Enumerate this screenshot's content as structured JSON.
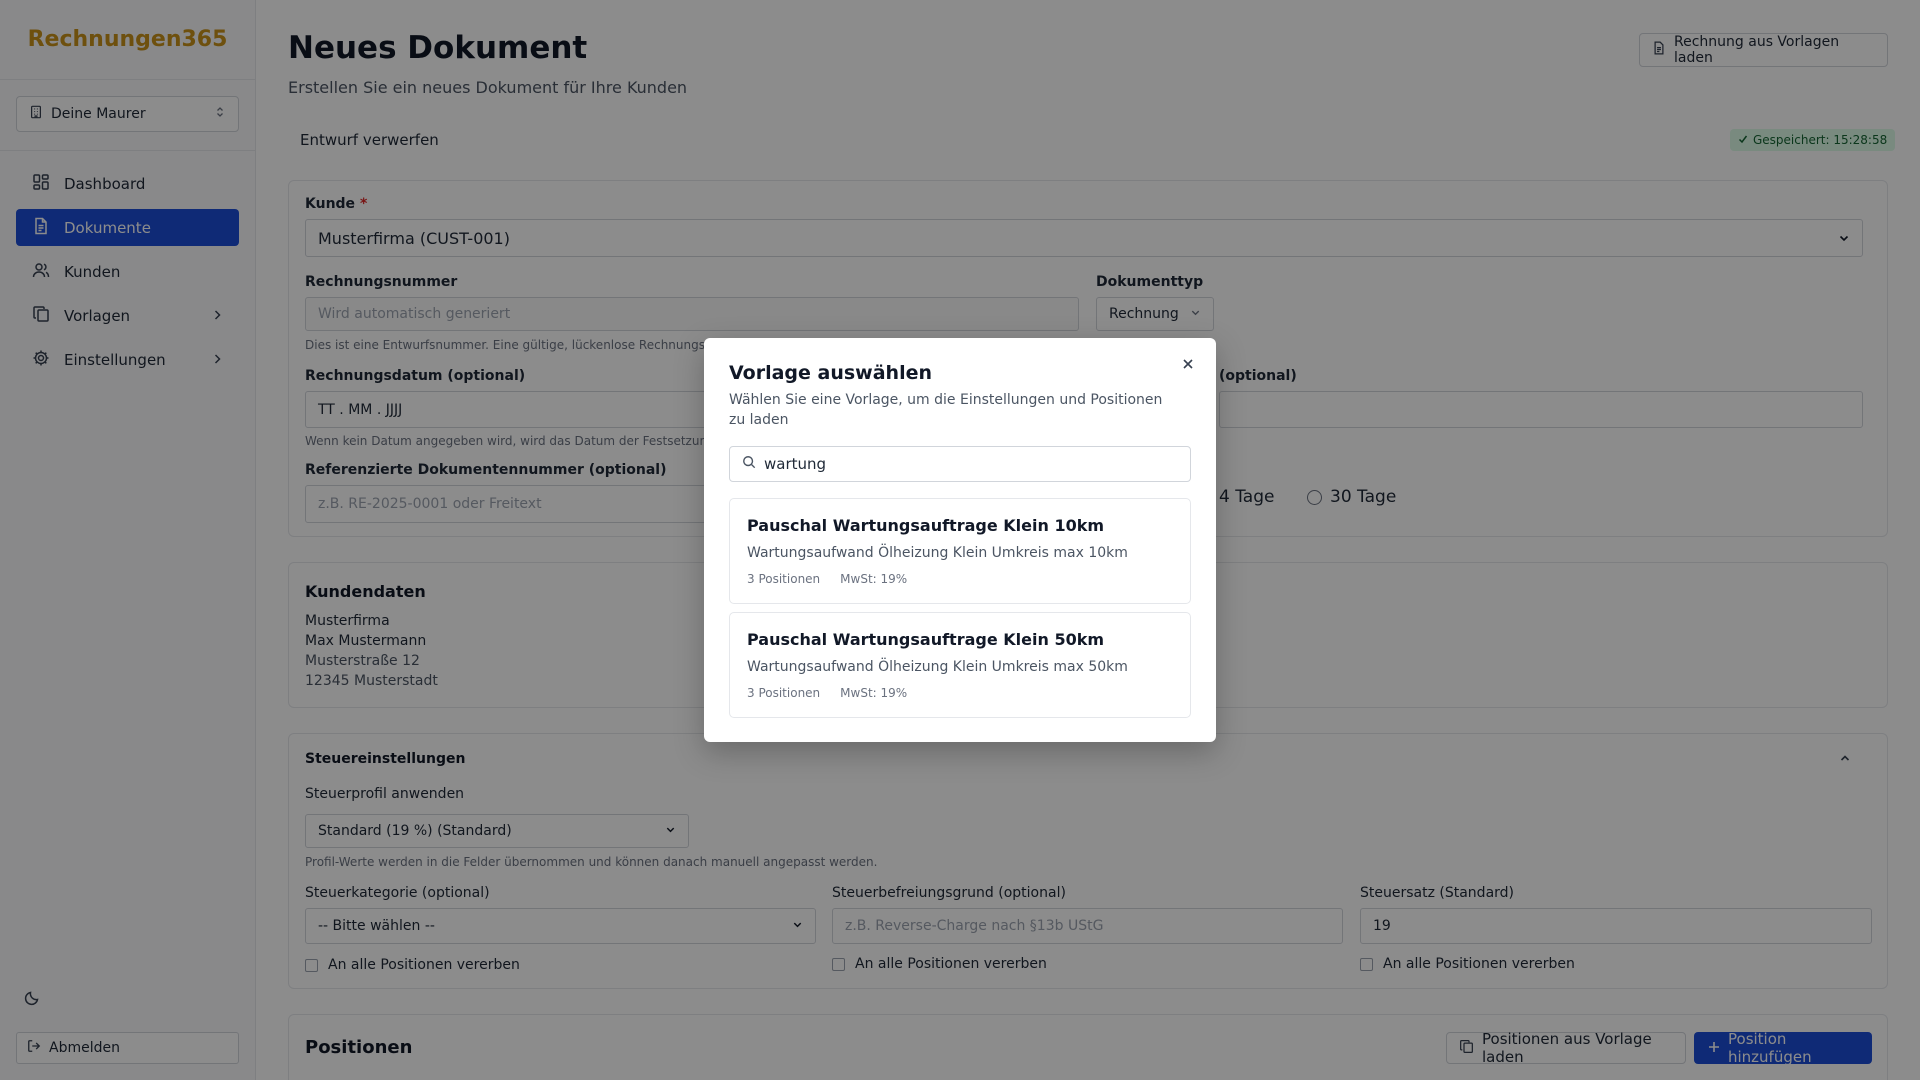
{
  "app": {
    "brand": "Rechnungen365"
  },
  "sidebar": {
    "company": "Deine Maurer",
    "items": [
      {
        "label": "Dashboard",
        "icon": "grid-icon"
      },
      {
        "label": "Dokumente",
        "icon": "document-icon",
        "active": true
      },
      {
        "label": "Kunden",
        "icon": "users-icon"
      },
      {
        "label": "Vorlagen",
        "icon": "copy-icon",
        "expandable": true
      },
      {
        "label": "Einstellungen",
        "icon": "gear-icon",
        "expandable": true
      }
    ],
    "logout": "Abmelden"
  },
  "header": {
    "title": "Neues Dokument",
    "subtitle": "Erstellen Sie ein neues Dokument für Ihre Kunden",
    "load_invoice_button": "Rechnung aus Vorlagen laden",
    "discard": "Entwurf verwerfen",
    "saved": "Gespeichert: 15:28:58"
  },
  "form": {
    "customer_label": "Kunde",
    "required_mark": "*",
    "customer_value": "Musterfirma (CUST-001)",
    "invoice_number_label": "Rechnungsnummer",
    "invoice_number_placeholder": "Wird automatisch generiert",
    "invoice_number_hint": "Dies ist eine Entwurfsnummer. Eine gültige, lückenlose Rechnungsnum",
    "doc_type_label": "Dokumenttyp",
    "doc_type_value": "Rechnung",
    "invoice_date_label": "Rechnungsdatum (optional)",
    "invoice_date_value": "TT . MM . JJJJ",
    "invoice_date_hint": "Wenn kein Datum angegeben wird, wird das Datum der Festsetzung ve",
    "right_optional_label": "(optional)",
    "ref_doc_label": "Referenzierte Dokumentennummer (optional)",
    "ref_doc_placeholder": "z.B. RE-2025-0001 oder Freitext",
    "radio_partial": "4 Tage",
    "radio_30": "30 Tage"
  },
  "customer_data": {
    "title": "Kundendaten",
    "company": "Musterfirma",
    "person": "Max Mustermann",
    "street": "Musterstraße 12",
    "city": "12345 Musterstadt"
  },
  "tax": {
    "title": "Steuereinstellungen",
    "profile_label": "Steuerprofil anwenden",
    "profile_value": "Standard (19 %) (Standard)",
    "profile_hint": "Profil-Werte werden in die Felder übernommen und können danach manuell angepasst werden.",
    "category_label": "Steuerkategorie (optional)",
    "category_value": "-- Bitte wählen --",
    "exemption_label": "Steuerbefreiungsgrund (optional)",
    "exemption_placeholder": "z.B. Reverse-Charge nach §13b UStG",
    "rate_label": "Steuersatz (Standard)",
    "rate_value": "19",
    "inherit": "An alle Positionen vererben"
  },
  "positions": {
    "title": "Positionen",
    "load_button": "Positionen aus Vorlage laden",
    "add_button": "Position hinzufügen"
  },
  "modal": {
    "title": "Vorlage auswählen",
    "subtitle": "Wählen Sie eine Vorlage, um die Einstellungen und Positionen zu laden",
    "search_value": "wartung",
    "templates": [
      {
        "name": "Pauschal Wartungsauftrage Klein 10km",
        "desc": "Wartungsaufwand Ölheizung Klein Umkreis max 10km",
        "positions": "3 Positionen",
        "vat": "MwSt: 19%"
      },
      {
        "name": "Pauschal Wartungsauftrage Klein 50km",
        "desc": "Wartungsaufwand Ölheizung Klein Umkreis max 50km",
        "positions": "3 Positionen",
        "vat": "MwSt: 19%"
      }
    ]
  },
  "colors": {
    "accent": "#1d4ed8",
    "brand": "#c8921a",
    "saved_bg": "#dcfce7",
    "saved_fg": "#166534"
  }
}
